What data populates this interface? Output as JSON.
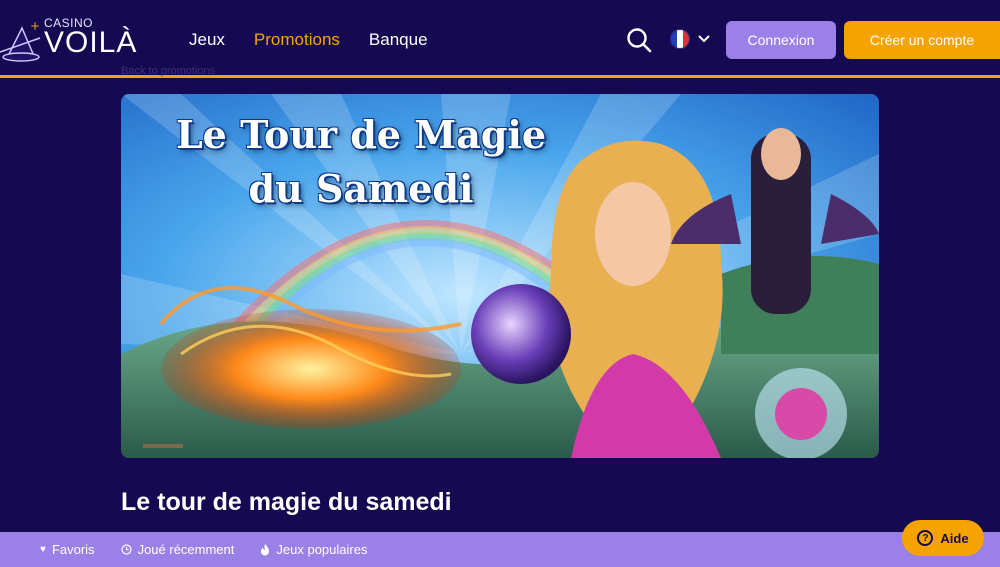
{
  "header": {
    "logo_small": "CASINO",
    "logo_big": "VOILÀ",
    "nav": [
      "Jeux",
      "Promotions",
      "Banque"
    ],
    "active_nav": "Promotions",
    "language": "FR",
    "login_label": "Connexion",
    "signup_label": "Créer un compte",
    "back_link": "Back to promotions"
  },
  "banner": {
    "title_line1": "Le Tour de Magie",
    "title_line2": "du Samedi"
  },
  "main": {
    "heading": "Le tour de magie du samedi"
  },
  "bottom_bar": {
    "items": [
      {
        "icon": "heart-icon",
        "label": "Favoris"
      },
      {
        "icon": "clock-icon",
        "label": "Joué récemment"
      },
      {
        "icon": "fire-icon",
        "label": "Jeux populaires"
      }
    ]
  },
  "help": {
    "label": "Aide"
  },
  "colors": {
    "background": "#150a52",
    "accent": "#f5a300",
    "lavender": "#9b80e8"
  }
}
